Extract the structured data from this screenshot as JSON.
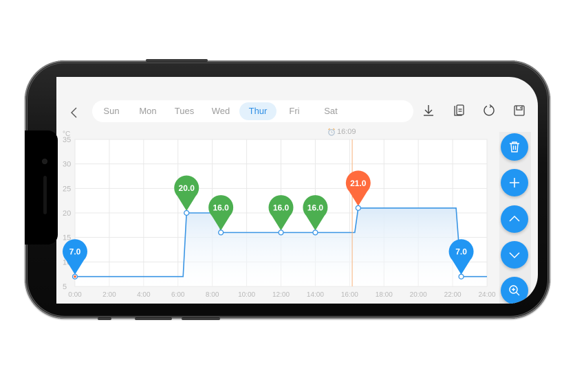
{
  "toolbar": {
    "back_icon": "chevron-left-icon",
    "days": [
      {
        "label": "Sun",
        "active": false
      },
      {
        "label": "Mon",
        "active": false
      },
      {
        "label": "Tues",
        "active": false
      },
      {
        "label": "Wed",
        "active": false
      },
      {
        "label": "Thur",
        "active": true
      },
      {
        "label": "Fri",
        "active": false
      },
      {
        "label": "Sat",
        "active": false
      }
    ],
    "actions": [
      "download-icon",
      "copy-icon",
      "refresh-icon",
      "save-icon"
    ]
  },
  "current_time": {
    "label": "16:09",
    "icon": "alarm-clock-icon",
    "hour": 16.15,
    "color": "#f7b27a"
  },
  "side_actions": [
    "trash-icon",
    "plus-icon",
    "chevron-up-icon",
    "chevron-down-icon",
    "zoom-in-icon"
  ],
  "colors": {
    "accent": "#2196f3",
    "comfort": "#4caf50",
    "active": "#ff6b3d",
    "line": "#3a95e4",
    "fill": "#dcebf9"
  },
  "chart_data": {
    "type": "line",
    "title": "",
    "xlabel": "",
    "ylabel": "°C",
    "xlim": [
      0,
      24
    ],
    "ylim": [
      5,
      35
    ],
    "grid": true,
    "x_ticks": [
      "0:00",
      "2:00",
      "4:00",
      "6:00",
      "8:00",
      "10:00",
      "12:00",
      "14:00",
      "16:00",
      "18:00",
      "20:00",
      "22:00",
      "24:00"
    ],
    "y_ticks": [
      "5",
      "10",
      "15",
      "20",
      "25",
      "30",
      "35"
    ],
    "series": [
      {
        "name": "temperature_profile",
        "points": [
          [
            0,
            7
          ],
          [
            6.3,
            7
          ],
          [
            6.5,
            20
          ],
          [
            8.3,
            20
          ],
          [
            8.5,
            16
          ],
          [
            12,
            16
          ],
          [
            14,
            16
          ],
          [
            16.3,
            16
          ],
          [
            16.5,
            21
          ],
          [
            22.2,
            21
          ],
          [
            22.5,
            7
          ],
          [
            24,
            7
          ]
        ]
      }
    ],
    "setpoints": [
      {
        "hour": 0.0,
        "value": 7.0,
        "label": "7.0",
        "kind": "eco"
      },
      {
        "hour": 6.5,
        "value": 20.0,
        "label": "20.0",
        "kind": "comfort"
      },
      {
        "hour": 8.5,
        "value": 16.0,
        "label": "16.0",
        "kind": "comfort"
      },
      {
        "hour": 12.0,
        "value": 16.0,
        "label": "16.0",
        "kind": "comfort"
      },
      {
        "hour": 14.0,
        "value": 16.0,
        "label": "16.0",
        "kind": "comfort"
      },
      {
        "hour": 16.5,
        "value": 21.0,
        "label": "21.0",
        "kind": "active"
      },
      {
        "hour": 22.5,
        "value": 7.0,
        "label": "7.0",
        "kind": "eco"
      }
    ]
  }
}
